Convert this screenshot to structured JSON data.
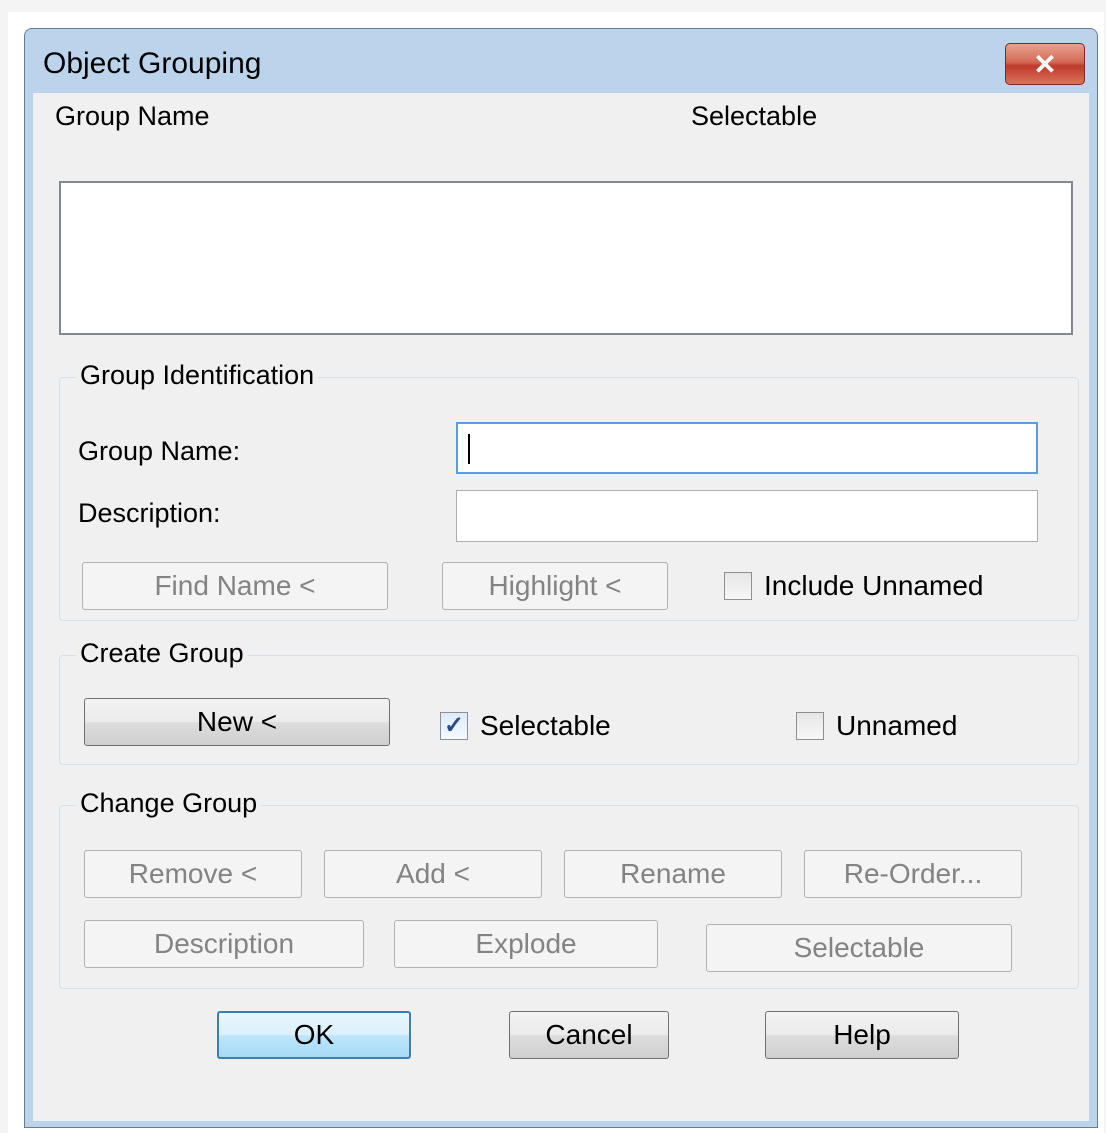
{
  "window": {
    "title": "Object Grouping"
  },
  "list": {
    "col_group_name": "Group Name",
    "col_selectable": "Selectable"
  },
  "identification": {
    "legend": "Group Identification",
    "group_name_label": "Group Name:",
    "group_name_value": "",
    "description_label": "Description:",
    "description_value": "",
    "find_name_button": "Find Name <",
    "highlight_button": "Highlight <",
    "include_unnamed_label": "Include Unnamed",
    "include_unnamed_checked": false
  },
  "create": {
    "legend": "Create Group",
    "new_button": "New <",
    "selectable_label": "Selectable",
    "selectable_checked": true,
    "unnamed_label": "Unnamed",
    "unnamed_checked": false
  },
  "change": {
    "legend": "Change Group",
    "remove_button": "Remove <",
    "add_button": "Add <",
    "rename_button": "Rename",
    "reorder_button": "Re-Order...",
    "description_button": "Description",
    "explode_button": "Explode",
    "selectable_button": "Selectable"
  },
  "footer": {
    "ok_button": "OK",
    "cancel_button": "Cancel",
    "help_button": "Help"
  }
}
